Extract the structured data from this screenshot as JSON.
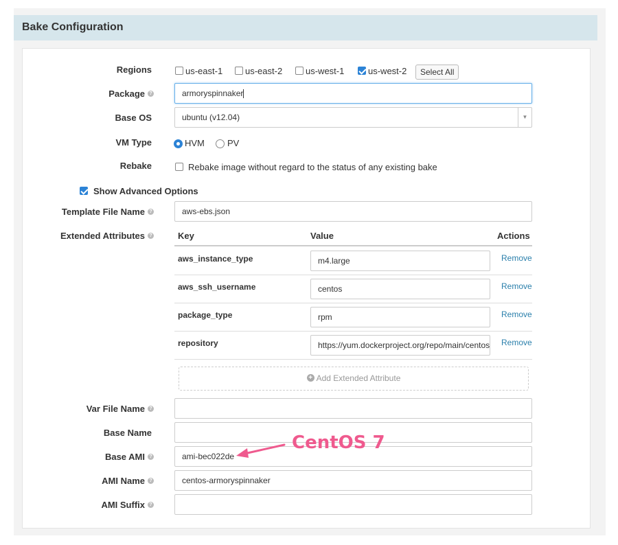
{
  "section": {
    "title": "Bake Configuration"
  },
  "regions": {
    "label": "Regions",
    "items": [
      {
        "label": "us-east-1",
        "checked": false
      },
      {
        "label": "us-east-2",
        "checked": false
      },
      {
        "label": "us-west-1",
        "checked": false
      },
      {
        "label": "us-west-2",
        "checked": true
      }
    ],
    "select_all": "Select All"
  },
  "package": {
    "label": "Package",
    "value": "armoryspinnaker"
  },
  "base_os": {
    "label": "Base OS",
    "value": "ubuntu (v12.04)"
  },
  "vm_type": {
    "label": "VM Type",
    "options": [
      "HVM",
      "PV"
    ],
    "selected": "HVM"
  },
  "rebake": {
    "label": "Rebake",
    "checkbox_label": "Rebake image without regard to the status of any existing bake",
    "checked": false
  },
  "advanced": {
    "label": "Show Advanced Options",
    "checked": true
  },
  "template_file": {
    "label": "Template File Name",
    "value": "aws-ebs.json"
  },
  "extended_attributes": {
    "label": "Extended Attributes",
    "columns": [
      "Key",
      "Value",
      "Actions"
    ],
    "rows": [
      {
        "key": "aws_instance_type",
        "value": "m4.large",
        "action": "Remove"
      },
      {
        "key": "aws_ssh_username",
        "value": "centos",
        "action": "Remove"
      },
      {
        "key": "package_type",
        "value": "rpm",
        "action": "Remove"
      },
      {
        "key": "repository",
        "value": "https://yum.dockerproject.org/repo/main/centos",
        "action": "Remove"
      }
    ],
    "add_label": "Add Extended Attribute"
  },
  "var_file": {
    "label": "Var File Name",
    "value": ""
  },
  "base_name": {
    "label": "Base Name",
    "value": ""
  },
  "base_ami": {
    "label": "Base AMI",
    "value": "ami-bec022de"
  },
  "ami_name": {
    "label": "AMI Name",
    "value": "centos-armoryspinnaker"
  },
  "ami_suffix": {
    "label": "AMI Suffix",
    "value": ""
  },
  "annotation": {
    "text": "CentOS 7",
    "color": "#ef5a8e"
  },
  "colors": {
    "accent": "#2c83d6",
    "header_bg": "#d6e6ec",
    "link": "#2a7fab"
  }
}
